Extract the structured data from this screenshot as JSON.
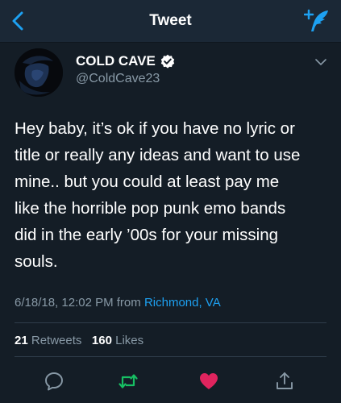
{
  "header": {
    "title": "Tweet",
    "back_icon": "chevron-left-icon",
    "compose_icon": "compose-feather-icon"
  },
  "tweet": {
    "author_name": "COLD CAVE",
    "verified": true,
    "author_handle": "@ColdCave23",
    "text": "Hey baby, it’s ok if you have no lyric or\ntitle or really any ideas and want to use\nmine.. but you could at least pay me\nlike the horrible pop punk emo bands\ndid in the early ’00s for your missing\nsouls.",
    "timestamp": "6/18/18, 12:02 PM from",
    "location": "Richmond, VA",
    "retweet_count": "21",
    "retweets_label": "Retweets",
    "like_count": "160",
    "likes_label": "Likes",
    "liked": true
  },
  "actions": [
    "reply-icon",
    "retweet-icon",
    "like-heart-icon",
    "share-icon"
  ],
  "colors": {
    "background": "#141d26",
    "header_bg": "#1b2836",
    "accent": "#1da1f2",
    "retweet_green": "#17bf63",
    "like_red": "#e0245e",
    "secondary_text": "#8899a6"
  }
}
